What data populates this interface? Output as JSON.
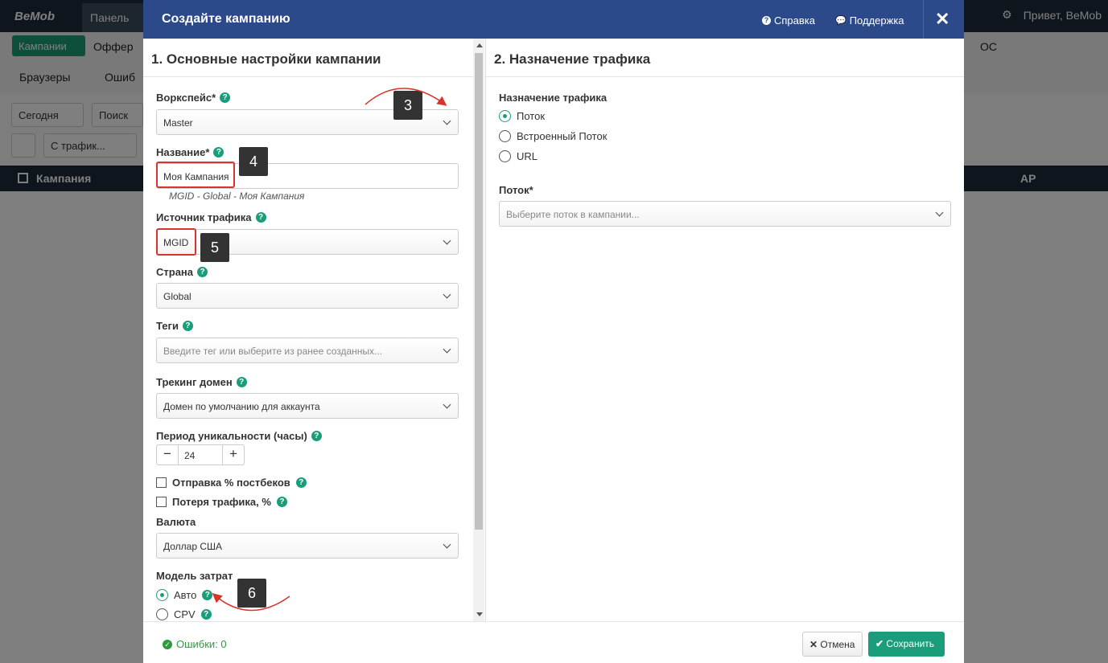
{
  "background": {
    "logo": "BeMob",
    "tab_dashboard": "Панель",
    "top_right_greeting": "Привет, BeMob",
    "nav": {
      "campaigns": "Кампании",
      "offers": "Оффер",
      "browsers": "Браузеры",
      "errors": "Ошиб",
      "os": "ОС"
    },
    "filters": {
      "date": "Сегодня",
      "search": "Поиск",
      "traffic": "С трафик..."
    },
    "table": {
      "col_campaign": "Кампания",
      "col_ap": "AP"
    }
  },
  "modal": {
    "title": "Создайте кампанию",
    "help_link": "Справка",
    "support_link": "Поддержка",
    "left": {
      "section_title": "1. Основные настройки кампании",
      "workspace": {
        "label": "Воркспейс*",
        "value": "Master"
      },
      "name": {
        "label": "Название*",
        "value": "Моя Кампания",
        "hint": "MGID - Global - Моя Кампания"
      },
      "traffic_source": {
        "label": "Источник трафика",
        "value": "MGID"
      },
      "country": {
        "label": "Страна",
        "value": "Global"
      },
      "tags": {
        "label": "Теги",
        "placeholder": "Введите тег или выберите из ранее созданных..."
      },
      "tracking_domain": {
        "label": "Трекинг домен",
        "value": "Домен по умолчанию для аккаунта"
      },
      "uniqueness": {
        "label": "Период уникальности (часы)",
        "value": "24",
        "minus": "−",
        "plus": "+"
      },
      "postback_check": "Отправка % постбеков",
      "traffic_loss_check": "Потеря трафика, %",
      "currency": {
        "label": "Валюта",
        "value": "Доллар США"
      },
      "cost_model": {
        "label": "Модель затрат",
        "option_auto": "Авто",
        "option_cpv": "CPV"
      }
    },
    "right": {
      "section_title": "2. Назначение трафика",
      "destination_label": "Назначение трафика",
      "options": [
        "Поток",
        "Встроенный Поток",
        "URL"
      ],
      "flow_label": "Поток*",
      "flow_placeholder": "Выберите поток в кампании..."
    },
    "footer": {
      "errors": "Ошибки: 0",
      "cancel": "Отмена",
      "save": "Сохранить"
    }
  },
  "annotations": [
    "3",
    "4",
    "5",
    "6"
  ],
  "colors": {
    "accent": "#1a9d7a",
    "header": "#2c4a8a",
    "annotation_red": "#d9342b"
  }
}
